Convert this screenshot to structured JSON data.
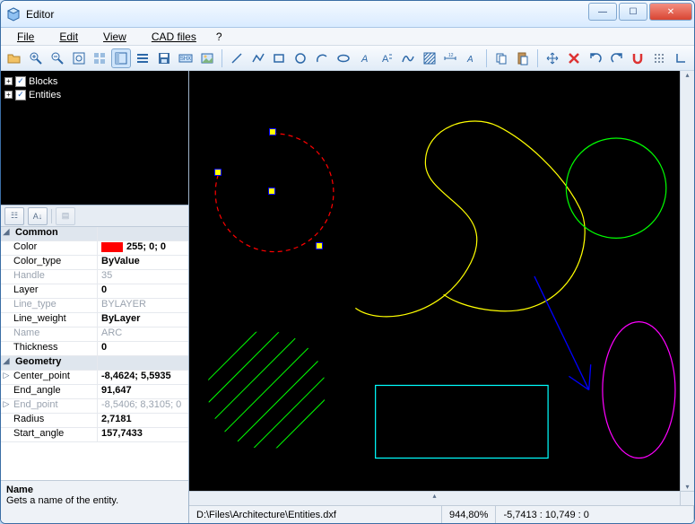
{
  "window": {
    "title": "Editor"
  },
  "menu": {
    "file": "File",
    "edit": "Edit",
    "view": "View",
    "cad": "CAD files",
    "help": "?"
  },
  "tree": {
    "blocks": "Blocks",
    "entities": "Entities"
  },
  "propcats": {
    "common": "Common",
    "geometry": "Geometry"
  },
  "props": {
    "color_k": "Color",
    "color_v": "255; 0; 0",
    "colortype_k": "Color_type",
    "colortype_v": "ByValue",
    "handle_k": "Handle",
    "handle_v": "35",
    "layer_k": "Layer",
    "layer_v": "0",
    "linetype_k": "Line_type",
    "linetype_v": "BYLAYER",
    "lineweight_k": "Line_weight",
    "lineweight_v": "ByLayer",
    "name_k": "Name",
    "name_v": "ARC",
    "thickness_k": "Thickness",
    "thickness_v": "0",
    "center_k": "Center_point",
    "center_v": "-8,4624; 5,5935",
    "endangle_k": "End_angle",
    "endangle_v": "91,647",
    "endpoint_k": "End_point",
    "endpoint_v": "-8,5406; 8,3105; 0",
    "radius_k": "Radius",
    "radius_v": "2,7181",
    "startangle_k": "Start_angle",
    "startangle_v": "157,7433"
  },
  "desc": {
    "name": "Name",
    "text": "Gets a name of the entity."
  },
  "status": {
    "path": "D:\\Files\\Architecture\\Entities.dxf",
    "zoom": "944,80%",
    "coords": "-5,7413 : 10,749 : 0"
  },
  "icons": {
    "open": "open-icon",
    "zoomin": "zoom-in-icon",
    "zoomout": "zoom-out-icon",
    "fit": "zoom-fit-icon",
    "grid": "grid-icon",
    "panel": "panel-icon",
    "layers": "layers-icon",
    "save": "save-icon",
    "shx": "shx-icon",
    "image": "image-icon",
    "line": "line-tool-icon",
    "polyline": "polyline-icon",
    "rect": "rect-tool-icon",
    "circle": "circle-tool-icon",
    "arc": "arc-tool-icon",
    "ellipse": "ellipse-tool-icon",
    "text": "text-icon",
    "mtext": "mtext-icon",
    "spline": "spline-icon",
    "hatch": "hatch-icon",
    "dim": "dimension-icon",
    "leader": "leader-icon",
    "copy": "copy-icon",
    "paste": "paste-icon",
    "move": "move-icon",
    "delete": "delete-icon",
    "undo": "undo-icon",
    "redo": "redo-icon",
    "snap": "snap-icon",
    "dots": "dots-icon",
    "ortho": "ortho-icon"
  }
}
